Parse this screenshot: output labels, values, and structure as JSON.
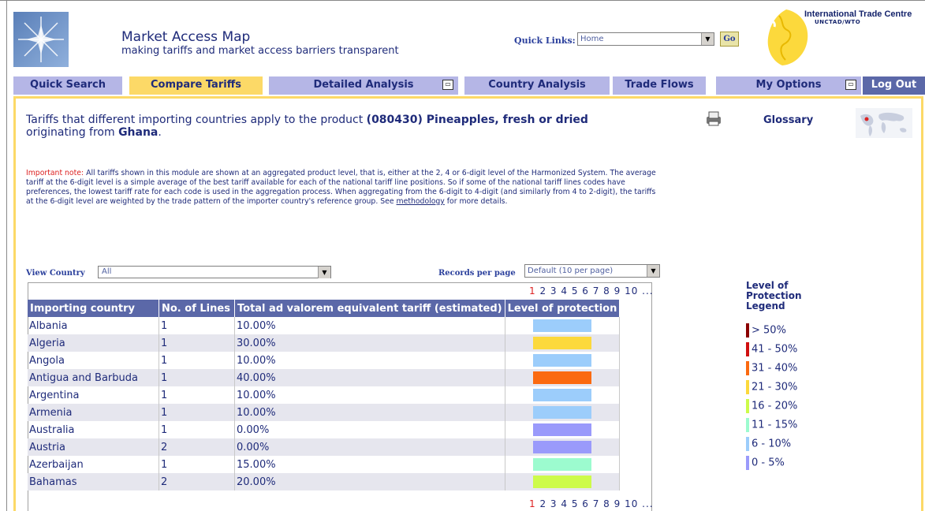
{
  "header": {
    "app_title": "Market Access Map",
    "app_subtitle": "making tariffs and market access barriers transparent",
    "quick_links_label": "Quick Links:",
    "quick_links_value": "Home",
    "go_label": "Go",
    "itc_name": "International Trade Centre",
    "itc_sub": "UNCTAD/WTO"
  },
  "nav": {
    "quick_search": "Quick Search",
    "compare_tariffs": "Compare Tariffs",
    "detailed_analysis": "Detailed Analysis",
    "country_analysis": "Country Analysis",
    "trade_flows": "Trade Flows",
    "my_options": "My Options",
    "log_out": "Log Out"
  },
  "main": {
    "headline_prefix": "Tariffs that different importing countries apply to the product ",
    "product": "(080430) Pineapples, fresh or dried",
    "headline_mid": "originating from ",
    "origin": "Ghana",
    "headline_end": ".",
    "glossary": "Glossary",
    "note_label": "Important note:",
    "note_text": " All tariffs shown in this module are shown at an aggregated product level, that is, either at the 2, 4 or 6-digit level of the Harmonized System. The average tariff at the 6-digit level is a simple average of the best tariff available for each of the national tariff line positions. So if some of the national tariff lines codes have preferences, the lowest tariff rate for each code is used in the aggregation process. When aggregating from the 6-digit to 4-digit (and similarly from 4 to 2-digit), the tariffs at the 6-digit level are weighted by the trade pattern of the importer country's reference group. See ",
    "note_link": "methodology",
    "note_end": " for more details.",
    "view_country_label": "View Country",
    "view_country_value": "All",
    "records_label": "Records per page",
    "records_value": "Default (10 per page)",
    "pager_current": "1",
    "pager_rest": "2 3 4 5 6 7 8 9 10 ..."
  },
  "table": {
    "headers": [
      "Importing country",
      "No. of Lines",
      "Total ad valorem equivalent tariff (estimated)",
      "Level of protection"
    ],
    "rows": [
      {
        "country": "Albania",
        "lines": "1",
        "tariff": "10.00%",
        "color": "#9ccdfb"
      },
      {
        "country": "Algeria",
        "lines": "1",
        "tariff": "30.00%",
        "color": "#fcd93c"
      },
      {
        "country": "Angola",
        "lines": "1",
        "tariff": "10.00%",
        "color": "#9ccdfb"
      },
      {
        "country": "Antigua and Barbuda",
        "lines": "1",
        "tariff": "40.00%",
        "color": "#fb6a10"
      },
      {
        "country": "Argentina",
        "lines": "1",
        "tariff": "10.00%",
        "color": "#9ccdfb"
      },
      {
        "country": "Armenia",
        "lines": "1",
        "tariff": "10.00%",
        "color": "#9ccdfb"
      },
      {
        "country": "Australia",
        "lines": "1",
        "tariff": "0.00%",
        "color": "#9a9afb"
      },
      {
        "country": "Austria",
        "lines": "2",
        "tariff": "0.00%",
        "color": "#9a9afb"
      },
      {
        "country": "Azerbaijan",
        "lines": "1",
        "tariff": "15.00%",
        "color": "#9cfbcf"
      },
      {
        "country": "Bahamas",
        "lines": "2",
        "tariff": "20.00%",
        "color": "#cdfb4a"
      }
    ]
  },
  "legend": {
    "title_lines": [
      "Level of",
      "Protection",
      "Legend"
    ],
    "items": [
      {
        "label": "> 50%",
        "color": "#8b0000"
      },
      {
        "label": "41 - 50%",
        "color": "#d01010"
      },
      {
        "label": "31 - 40%",
        "color": "#fb6a10"
      },
      {
        "label": "21 - 30%",
        "color": "#fcd93c"
      },
      {
        "label": "16 - 20%",
        "color": "#cdfb4a"
      },
      {
        "label": "11 - 15%",
        "color": "#9cfbcf"
      },
      {
        "label": "6 - 10%",
        "color": "#9ccdfb"
      },
      {
        "label": "0 - 5%",
        "color": "#9a9afb"
      }
    ]
  }
}
